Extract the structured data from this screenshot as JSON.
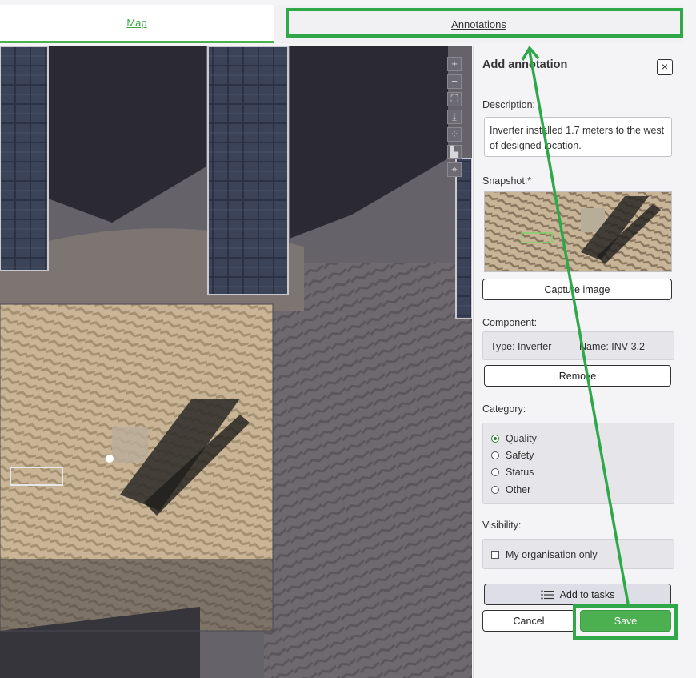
{
  "tabs": {
    "map_label": "Map",
    "annotations_label": "Annotations"
  },
  "map_controls": [
    "+",
    "−",
    "⛶",
    "⤓",
    "⁘",
    "▙",
    "⌖"
  ],
  "panel": {
    "title": "Add annotation",
    "close_label": "×",
    "description_label": "Description:",
    "description_value": "Inverter installed 1.7 meters to the west of designed location.",
    "snapshot_label": "Snapshot:*",
    "capture_label": "Capture image",
    "component_label": "Component:",
    "type_text": "Type:  Inverter",
    "name_text": "Name:  INV 3.2",
    "remove_label": "Remove",
    "category_label": "Category:",
    "categories": [
      "Quality",
      "Safety",
      "Status",
      "Other"
    ],
    "selected_category": "Quality",
    "visibility_label": "Visibility:",
    "visibility_option": "My organisation only",
    "add_tasks_label": "Add to tasks",
    "cancel_label": "Cancel",
    "save_label": "Save"
  },
  "colors": {
    "accent": "#4caf50",
    "highlight": "#2fa84a"
  }
}
